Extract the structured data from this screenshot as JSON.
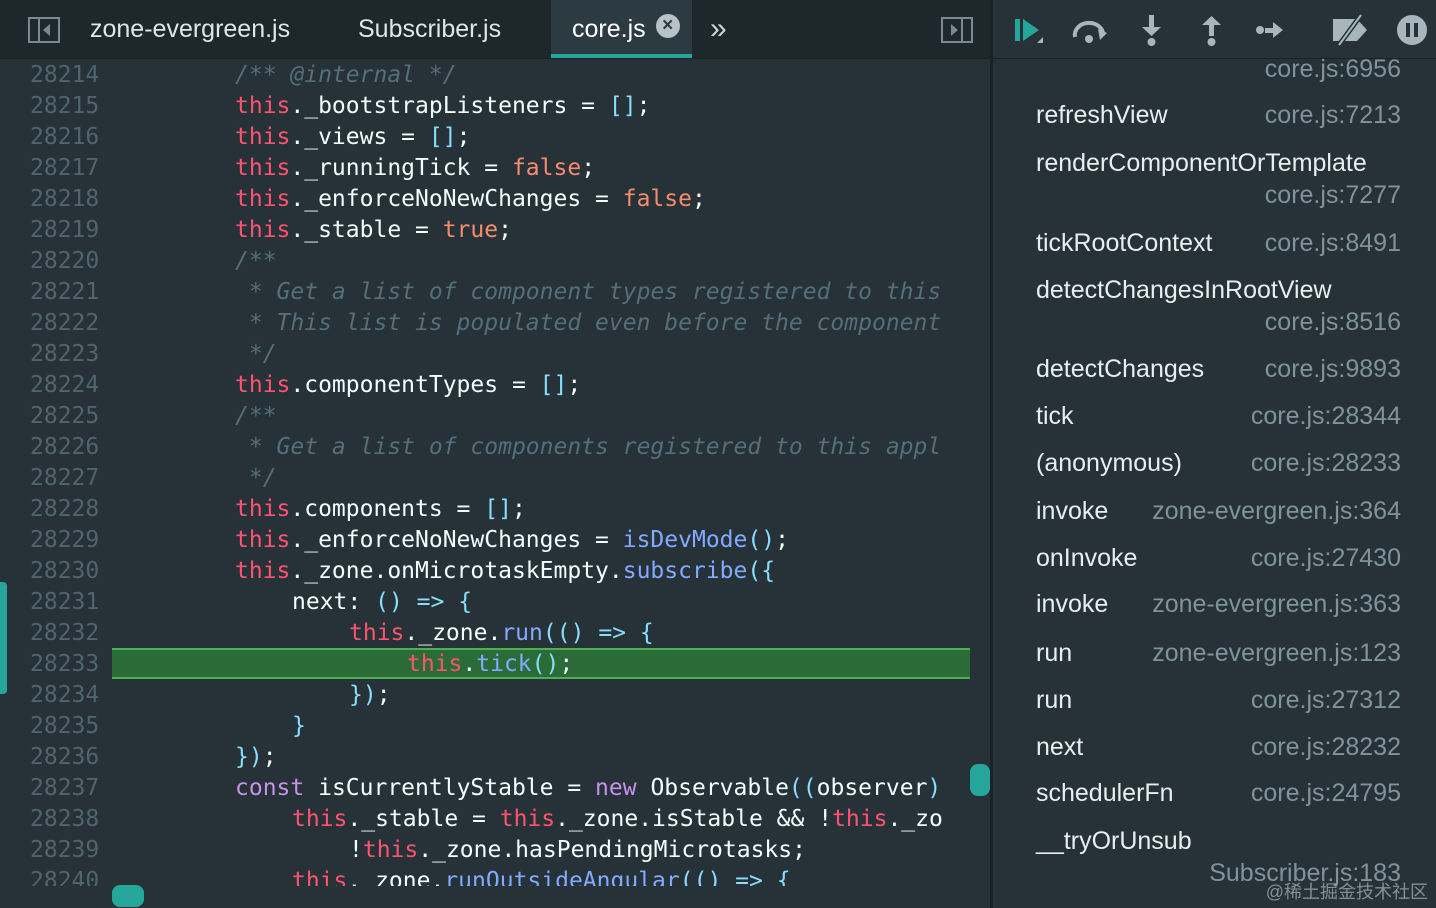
{
  "tabs": [
    {
      "label": "zone-evergreen.js",
      "active": false
    },
    {
      "label": "Subscriber.js",
      "active": false
    },
    {
      "label": "core.js",
      "active": true
    }
  ],
  "tab_close_glyph": "×",
  "tab_overflow_glyph": "»",
  "icons": {
    "toggle_sidebar": "sidebar-left-icon",
    "toggle_debugger": "sidebar-right-icon",
    "resume": "resume-icon",
    "step_over": "step-over-icon",
    "step_into": "step-into-icon",
    "step_out": "step-out-icon",
    "step": "step-icon",
    "deactivate_breakpoints": "deactivate-breakpoints-icon",
    "pause_on_exceptions": "pause-icon"
  },
  "line_numbers": [
    "28214",
    "28215",
    "28216",
    "28217",
    "28218",
    "28219",
    "28220",
    "28221",
    "28222",
    "28223",
    "28224",
    "28225",
    "28226",
    "28227",
    "28228",
    "28229",
    "28230",
    "28231",
    "28232",
    "28233",
    "28234",
    "28235",
    "28236",
    "28237",
    "28238",
    "28239",
    "28240"
  ],
  "code": {
    "l28214": "/** @internal */",
    "l28215": "this._bootstrapListeners = [];",
    "l28216": "this._views = [];",
    "l28217": "this._runningTick = false;",
    "l28218": "this._enforceNoNewChanges = false;",
    "l28219": "this._stable = true;",
    "l28220": "/**",
    "l28221": " * Get a list of component types registered to this",
    "l28222": " * This list is populated even before the component",
    "l28223": " */",
    "l28224": "this.componentTypes = [];",
    "l28225": "/**",
    "l28226": " * Get a list of components registered to this appl",
    "l28227": " */",
    "l28228": "this.components = [];",
    "l28229": "this._enforceNoNewChanges = isDevMode();",
    "l28230": "this._zone.onMicrotaskEmpty.subscribe({",
    "l28231": "next: () => {",
    "l28232": "this._zone.run(() => {",
    "l28233": "this.tick();",
    "l28234": "});",
    "l28235": "}",
    "l28236": "});",
    "l28237": "const isCurrentlyStable = new Observable((observer)",
    "l28238": "this._stable = this._zone.isStable && !this._zo",
    "l28239": "!this._zone.hasPendingMicrotasks;",
    "l28240": "this._zone.runOutsideAngular(() => {"
  },
  "call_stack": [
    {
      "name": "",
      "location": "core.js:6956"
    },
    {
      "name": "refreshView",
      "location": "core.js:7213"
    },
    {
      "name": "renderComponentOrTemplate",
      "location": "core.js:7277"
    },
    {
      "name": "tickRootContext",
      "location": "core.js:8491"
    },
    {
      "name": "detectChangesInRootView",
      "location": "core.js:8516"
    },
    {
      "name": "detectChanges",
      "location": "core.js:9893"
    },
    {
      "name": "tick",
      "location": "core.js:28344"
    },
    {
      "name": "(anonymous)",
      "location": "core.js:28233"
    },
    {
      "name": "invoke",
      "location": "zone-evergreen.js:364"
    },
    {
      "name": "onInvoke",
      "location": "core.js:27430"
    },
    {
      "name": "invoke",
      "location": "zone-evergreen.js:363"
    },
    {
      "name": "run",
      "location": "zone-evergreen.js:123"
    },
    {
      "name": "run",
      "location": "core.js:27312"
    },
    {
      "name": "next",
      "location": "core.js:28232"
    },
    {
      "name": "schedulerFn",
      "location": "core.js:24795"
    },
    {
      "name": "__tryOrUnsub",
      "location": "Subscriber.js:183"
    }
  ],
  "watermark": "@稀土掘金技术社区",
  "colors": {
    "background": "#263238",
    "accent": "#26a69a",
    "current_line": "#2b6b37",
    "keyword": "#c792ea",
    "this": "#ff5370",
    "function": "#82aaff",
    "boolean": "#f78c6c",
    "comment": "#546e7a"
  }
}
